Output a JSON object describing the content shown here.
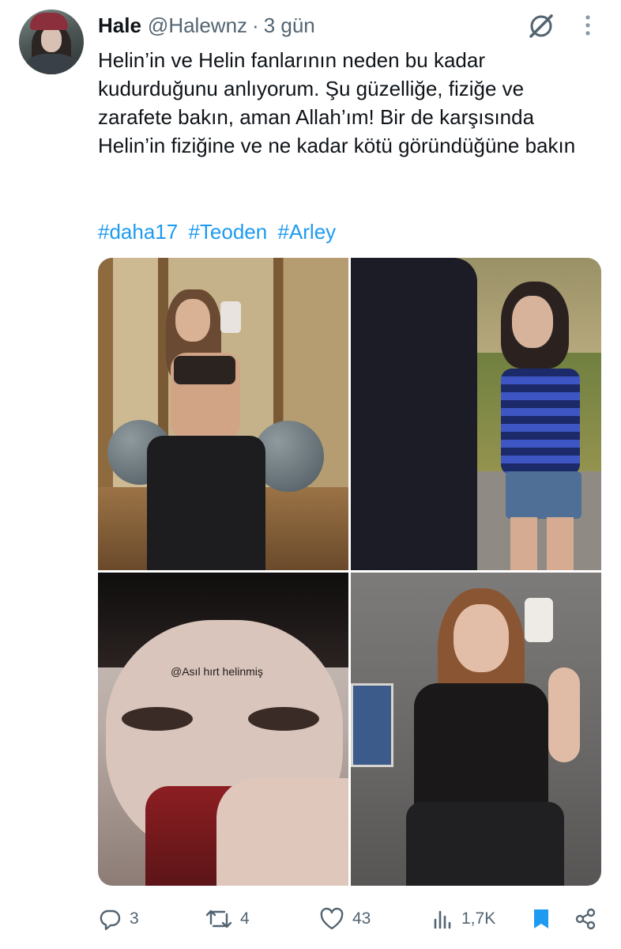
{
  "tweet": {
    "author_name": "Hale",
    "handle": "@Halewnz",
    "separator": "·",
    "time": "3 gün",
    "text": "Helin’in ve Helin fanlarının neden bu kadar kudurduğunu anlıyorum. Şu güzelliğe, fiziğe ve zarafete bakın, aman Allah’ım! Bir de karşısında Helin’in fiziğine ve ne kadar kötü göründüğüne bakın",
    "hashtags": [
      "#daha17",
      "#Teoden",
      "#Arley"
    ],
    "media_caption": "@Asıl hırt helinmiş"
  },
  "actions": {
    "replies": "3",
    "retweets": "4",
    "likes": "43",
    "views": "1,7K"
  },
  "colors": {
    "link": "#1d9bf0",
    "muted": "#536471",
    "bookmark_active": "#1d9bf0"
  },
  "icons": [
    "grok-icon",
    "more-icon",
    "reply-icon",
    "retweet-icon",
    "like-icon",
    "views-icon",
    "bookmark-icon",
    "share-icon"
  ]
}
